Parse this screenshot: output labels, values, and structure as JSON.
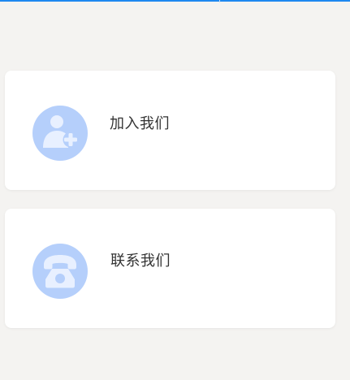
{
  "colors": {
    "background": "#f4f3f1",
    "card": "#ffffff",
    "icon_circle": "#b5cffb",
    "icon_glyph": "#e8f0ff",
    "text": "#333333",
    "top_accent": "#1e88f0"
  },
  "cards": [
    {
      "label": "加入我们",
      "icon": "add-user-icon"
    },
    {
      "label": "联系我们",
      "icon": "telephone-icon"
    }
  ]
}
